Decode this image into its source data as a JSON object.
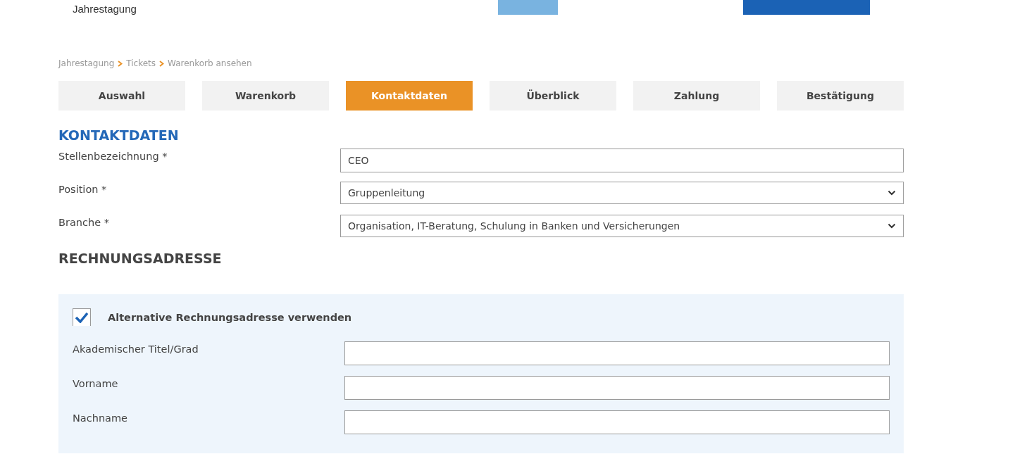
{
  "header": {
    "site_title": "Jahrestagung"
  },
  "breadcrumb": [
    "Jahrestagung",
    "Tickets",
    "Warenkorb ansehen"
  ],
  "steps": [
    {
      "label": "Auswahl",
      "selected": false
    },
    {
      "label": "Warenkorb",
      "selected": false
    },
    {
      "label": "Kontaktdaten",
      "selected": true
    },
    {
      "label": "Überblick",
      "selected": false
    },
    {
      "label": "Zahlung",
      "selected": false
    },
    {
      "label": "Bestätigung",
      "selected": false
    }
  ],
  "contact_section": {
    "title": "KONTAKTDATEN",
    "fields": [
      {
        "kind": "text",
        "label": "Stellenbezeichnung *",
        "value": "CEO"
      },
      {
        "kind": "select",
        "label": "Position *",
        "value": "Gruppenleitung"
      },
      {
        "kind": "select",
        "label": "Branche *",
        "value": "Organisation, IT-Beratung, Schulung in Banken und Versicherungen"
      }
    ]
  },
  "billing_section": {
    "title": "RECHNUNGSADRESSE",
    "alternative_address": {
      "label": "Alternative Rechnungsadresse verwenden",
      "checked": true
    },
    "fields": [
      {
        "label": "Akademischer Titel/Grad"
      },
      {
        "label": "Vorname"
      },
      {
        "label": "Nachname"
      }
    ]
  }
}
